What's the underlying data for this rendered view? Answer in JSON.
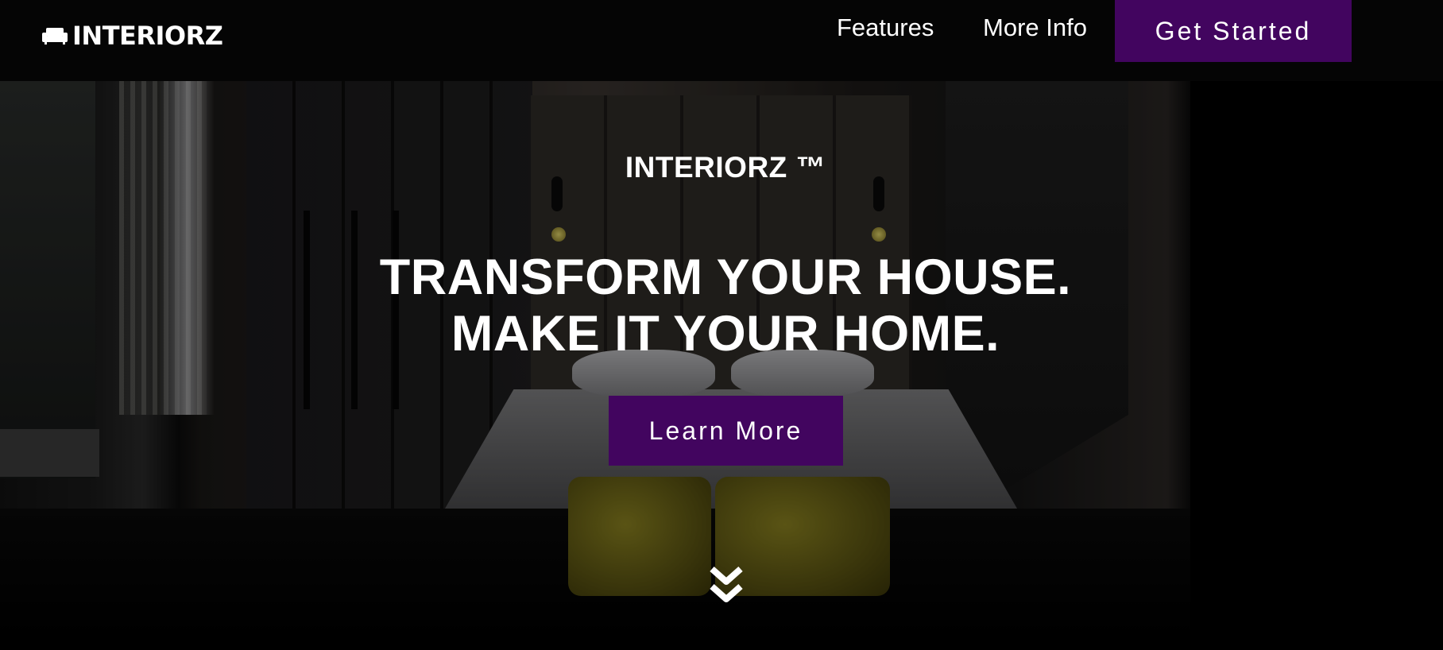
{
  "header": {
    "logo_text": "INTERIORZ",
    "logo_icon": "couch-icon",
    "nav": [
      {
        "label": "Features"
      },
      {
        "label": "More Info"
      }
    ],
    "cta_label": "Get Started"
  },
  "hero": {
    "brand_tag": "INTERIORZ ™",
    "headline_line1": "TRANSFORM YOUR HOUSE.",
    "headline_line2": "MAKE IT YOUR HOME.",
    "button_label": "Learn More",
    "scroll_icon": "double-chevron-down-icon"
  },
  "colors": {
    "accent": "#42055f",
    "header_bg": "#050505",
    "text": "#ffffff"
  }
}
